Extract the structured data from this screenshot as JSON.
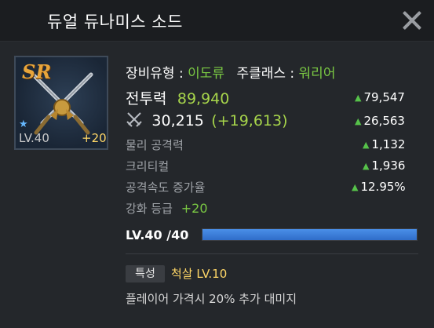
{
  "window": {
    "title": "듀얼 듀나미스 소드"
  },
  "item": {
    "grade": "SR",
    "level_label": "LV.40",
    "enhance_badge": "+20"
  },
  "equip_info": {
    "type_label": "장비유형 :",
    "type_value": "이도류",
    "class_label": "주클래스 :",
    "class_value": "워리어"
  },
  "stats": {
    "combat_label": "전투력",
    "combat_value": "89,940",
    "combat_delta": "79,547",
    "attack_value": "30,215",
    "attack_bonus": "(+19,613)",
    "attack_delta": "26,563",
    "rows": [
      {
        "label": "물리 공격력",
        "delta": "1,132"
      },
      {
        "label": "크리티컬",
        "delta": "1,936"
      },
      {
        "label": "공격속도 증가율",
        "delta": "12.95%"
      }
    ],
    "enhance_label": "강화 등급",
    "enhance_value": "+20"
  },
  "level_bar": {
    "label": "LV.40 /40",
    "progress": 1.0
  },
  "trait": {
    "tag": "특성",
    "name": "척살 LV.10",
    "description": "플레이어 가격시 20% 추가 대미지"
  },
  "colors": {
    "accent_green": "#7ac943",
    "delta_up": "#56c24a",
    "bar_fill": "#3a7fdc",
    "gold": "#ffd767"
  }
}
